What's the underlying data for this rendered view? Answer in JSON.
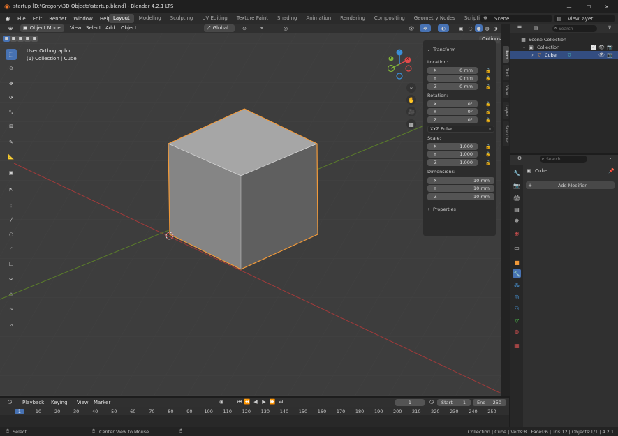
{
  "window": {
    "title": "startup [D:\\Gregory\\3D Objects\\startup.blend] - Blender 4.2.1 LTS",
    "min_label": "—",
    "max_label": "☐",
    "close_label": "✕"
  },
  "menu": [
    "File",
    "Edit",
    "Render",
    "Window",
    "Help"
  ],
  "workspaces": [
    "Layout",
    "Modeling",
    "Sculpting",
    "UV Editing",
    "Texture Paint",
    "Shading",
    "Animation",
    "Rendering",
    "Compositing",
    "Geometry Nodes",
    "Scripting"
  ],
  "workspace_add": "+",
  "scene": {
    "label": "Scene",
    "view_layer": "ViewLayer"
  },
  "viewport": {
    "mode": "Object Mode",
    "menus": [
      "View",
      "Select",
      "Add",
      "Object"
    ],
    "orientation": "Global",
    "options": "Options",
    "overlay_title": "User Orthographic",
    "overlay_subtitle": "(1) Collection | Cube",
    "gizmo": {
      "x": "X",
      "y": "Y",
      "z": "Z"
    }
  },
  "sidebar_tabs": [
    "Item",
    "Tool",
    "View",
    "Layer",
    "Sketcher"
  ],
  "transform": {
    "title": "Transform",
    "location_label": "Location:",
    "location": [
      {
        "axis": "X",
        "value": "0 mm"
      },
      {
        "axis": "Y",
        "value": "0 mm"
      },
      {
        "axis": "Z",
        "value": "0 mm"
      }
    ],
    "rotation_label": "Rotation:",
    "rotation": [
      {
        "axis": "X",
        "value": "0°"
      },
      {
        "axis": "Y",
        "value": "0°"
      },
      {
        "axis": "Z",
        "value": "0°"
      }
    ],
    "rotation_mode": "XYZ Euler",
    "scale_label": "Scale:",
    "scale": [
      {
        "axis": "X",
        "value": "1.000"
      },
      {
        "axis": "Y",
        "value": "1.000"
      },
      {
        "axis": "Z",
        "value": "1.000"
      }
    ],
    "dimensions_label": "Dimensions:",
    "dimensions": [
      {
        "axis": "X",
        "value": "10 mm"
      },
      {
        "axis": "Y",
        "value": "10 mm"
      },
      {
        "axis": "Z",
        "value": "10 mm"
      }
    ],
    "properties_label": "Properties"
  },
  "outliner": {
    "search_placeholder": "Search",
    "scene_collection": "Scene Collection",
    "collection": "Collection",
    "cube": "Cube"
  },
  "properties": {
    "search_placeholder": "Search",
    "object_name": "Cube",
    "add_modifier": "Add Modifier"
  },
  "timeline": {
    "menus": [
      "Playback",
      "Keying",
      "View",
      "Marker"
    ],
    "current_frame": "1",
    "start_label": "Start",
    "start": "1",
    "end_label": "End",
    "end": "250",
    "ruler": [
      "1",
      "10",
      "20",
      "30",
      "40",
      "50",
      "60",
      "70",
      "80",
      "90",
      "100",
      "110",
      "120",
      "130",
      "140",
      "150",
      "160",
      "170",
      "180",
      "190",
      "200",
      "210",
      "220",
      "230",
      "240",
      "250"
    ]
  },
  "status": {
    "left": "Select",
    "middle": "Center View to Mouse",
    "right": "Collection | Cube | Verts:8 | Faces:6 | Tris:12 | Objects:1/1 | 4.2.1"
  },
  "colors": {
    "accent": "#4772b3",
    "selection": "#f29a3a",
    "x_axis": "#e04a4a",
    "y_axis": "#7fb03a",
    "z_axis": "#3b8fd8"
  }
}
